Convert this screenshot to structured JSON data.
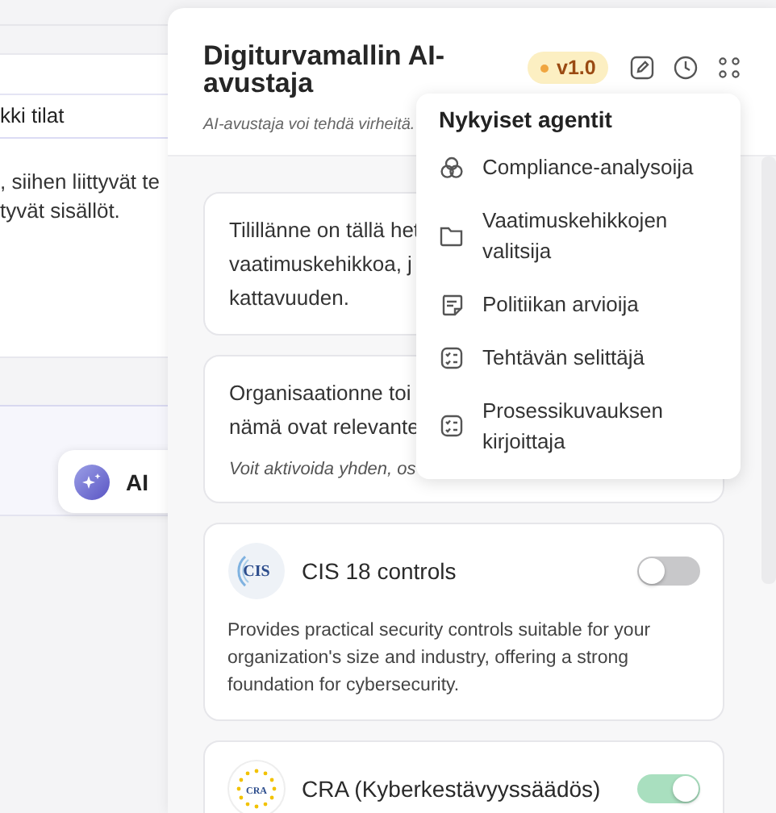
{
  "background": {
    "field_value": "kki tilat",
    "text_lines": [
      ", siihen liittyvät te",
      "tyvät sisällöt."
    ],
    "ai_button": "AI"
  },
  "panel": {
    "title": "Digiturvamallin AI-avustaja",
    "version": "v1.0",
    "disclaimer": "AI-avustaja voi tehdä virheitä."
  },
  "messages": [
    {
      "lines": [
        "Tilillänne on tällä het",
        "vaatimuskehikkoa, j",
        "kattavuuden."
      ]
    },
    {
      "lines": [
        "Organisaationne toi",
        "nämä ovat relevante"
      ],
      "note": "Voit aktivoida yhden, os"
    }
  ],
  "frameworks": [
    {
      "logo": "CIS",
      "kind": "cis",
      "name": "CIS 18 controls",
      "on": false,
      "description": "Provides practical security controls suitable for your organization's size and industry, offering a strong foundation for cybersecurity."
    },
    {
      "logo": "CRA",
      "kind": "eu",
      "name": "CRA (Kyberkestävyyssäädös)",
      "on": true
    }
  ],
  "agent_menu": {
    "title": "Nykyiset agentit",
    "items": [
      {
        "label": "Compliance-analysoija",
        "kind": "circles"
      },
      {
        "label": "Vaatimuskehikkojen valitsija",
        "kind": "folder"
      },
      {
        "label": "Politiikan arvioija",
        "kind": "note"
      },
      {
        "label": "Tehtävän selittäjä",
        "kind": "checklist"
      },
      {
        "label": "Prosessikuvauksen kirjoittaja",
        "kind": "checklist"
      }
    ]
  }
}
